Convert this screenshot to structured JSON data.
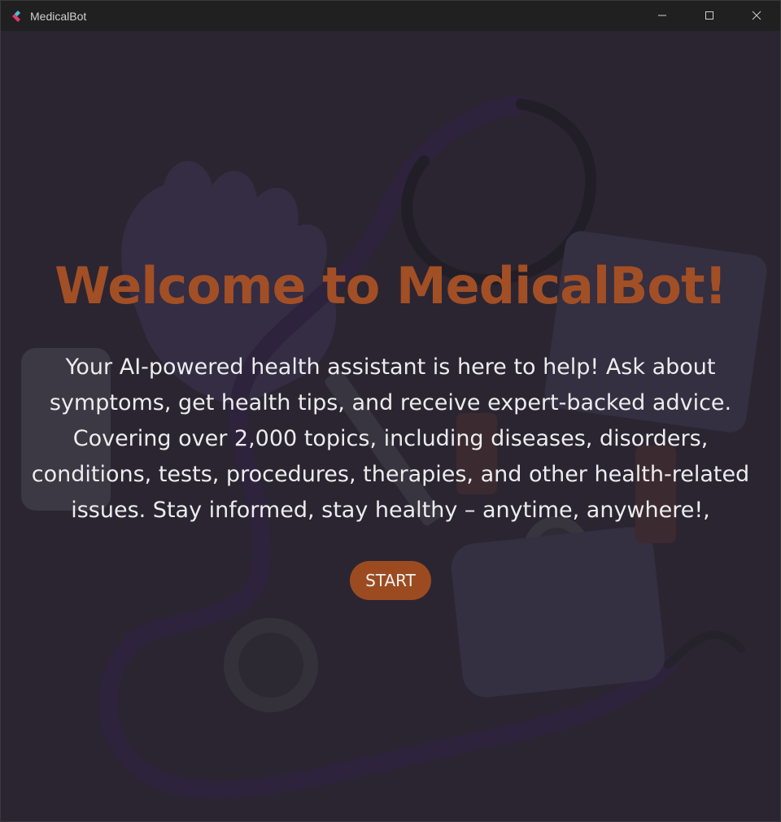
{
  "window": {
    "title": "MedicalBot",
    "app_icon": "medicalbot-logo-icon",
    "controls": [
      "minimize-icon",
      "maximize-icon",
      "close-icon"
    ]
  },
  "hero": {
    "title": "Welcome to MedicalBot!",
    "description": "Your AI-powered health assistant is here to help! Ask about symptoms, get health tips, and receive expert-backed advice. Covering over 2,000 topics, including diseases, disorders, conditions, tests, procedures, therapies, and other health-related issues. Stay informed, stay healthy – anytime, anywhere!,",
    "start_label": "START"
  },
  "colors": {
    "accent": "#9c4b20",
    "title": "#a24f25",
    "background": "#2c2934",
    "titlebar": "#202020"
  }
}
